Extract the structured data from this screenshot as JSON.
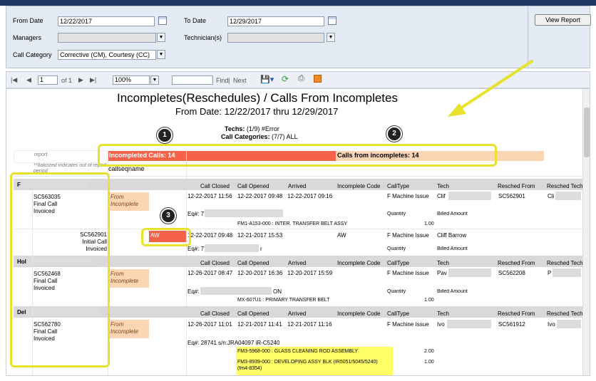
{
  "params": {
    "from_date_label": "From Date",
    "from_date": "12/22/2017",
    "to_date_label": "To Date",
    "to_date": "12/29/2017",
    "managers_label": "Managers",
    "technicians_label": "Technician(s)",
    "call_category_label": "Call Category",
    "call_category": "Corrective (CM), Courtesy (CC)",
    "view_report": "View Report"
  },
  "toolbar": {
    "page": "1",
    "of": "of 1",
    "zoom": "100%",
    "find": "Find",
    "next": "Next"
  },
  "report": {
    "title": "Incompletes(Reschedules) / Calls From Incompletes",
    "subtitle": "From Date: 12/22/2017 thru 12/29/2017",
    "techs_label": "Techs:",
    "techs_value": "(1/9) #Error",
    "cats_label": "Call Categories:",
    "cats_value": "(7/7) ALL",
    "report_note": "report",
    "italic_note": "**Italicized indicates out of report period",
    "callseq": "callseqname",
    "incompleted": "Incompleted Calls: 14",
    "from_incompletes": "Calls from incompletes: 14"
  },
  "columns": [
    "Call Closed",
    "Call Opened",
    "Arrived",
    "Incomplete Code",
    "CallType",
    "Tech",
    "Resched From",
    "Resched Tech"
  ],
  "sub_cols": {
    "qty": "Quantity",
    "billed": "Billed Amount"
  },
  "groups": [
    {
      "prefix": "F",
      "rows": [
        {
          "call": "SC563035",
          "status1": "Final Call",
          "status2": "Invoiced",
          "from": "From",
          "inc": "Incomplete",
          "closed": "12-22-2017 11:56",
          "opened": "12-22-2017 09:48",
          "arrived": "12-22-2017 09:16",
          "code": "",
          "type": "F Machine Issue",
          "tech": "Clif",
          "resched": "SC562901",
          "rtech": "Cli",
          "eq": "Eq#: 77",
          "part": "FM1-A153-000 : INTER. TRANSFER BELT ASSY",
          "qty": "1.00"
        },
        {
          "call": "SC562901",
          "status1": "Initial Call",
          "status2": "Invoiced",
          "aw": "AW",
          "closed": "12-22-2017 09:48",
          "opened": "12-21-2017 15:53",
          "arrived": "",
          "code": "AW",
          "type": "F Machine Issue",
          "tech": "Cliff Barrow",
          "eq": "Eq#: 77",
          "eq_tail": "r"
        }
      ]
    },
    {
      "prefix": "Hol",
      "rows": [
        {
          "call": "SC562468",
          "status1": "Final Call",
          "status2": "Invoiced",
          "from": "From",
          "inc": "Incomplete",
          "closed": "12-26-2017 08:47",
          "opened": "12-20-2017 16:36",
          "arrived": "12-20-2017 15:59",
          "type": "F Machine Issue",
          "tech": "Pav",
          "resched": "SC562208",
          "rtech": "P",
          "eq": "Eq#: 7",
          "eq_tail": "ON",
          "part": "MX-607U1 : PRIMARY TRANSFER BELT",
          "qty": "1.00"
        }
      ]
    },
    {
      "prefix": "Del",
      "rows": [
        {
          "call": "SC562780",
          "status1": "Final Call",
          "status2": "Invoiced",
          "from": "From",
          "inc": "Incomplete",
          "closed": "12-26-2017 11:01",
          "opened": "12-21-2017 11:41",
          "arrived": "12-21-2017 11:16",
          "type": "F Machine Issue",
          "tech": "Ivo",
          "resched": "SC561912",
          "rtech": "Ivo",
          "eq": "Eq#: 28741 s/n:JRA04097 iR-C5240",
          "part1": "FM3-5968-000 : GLASS CLEANING ROD ASSEMBLY",
          "qty1": "2.00",
          "part2": "FM3-8939-000 : DEVELOPING ASSY BLK (IR5051/5045/5240)",
          "part2b": "(fm4-8354)",
          "qty2": "1.00"
        }
      ]
    }
  ],
  "badges": [
    "1",
    "2",
    "3"
  ],
  "colors": {
    "red": "#f4624a",
    "orange": "#fcd5b4",
    "callout": "#e7e22b",
    "header": "#d9d9d9",
    "params_bg": "#e5ebf4"
  }
}
